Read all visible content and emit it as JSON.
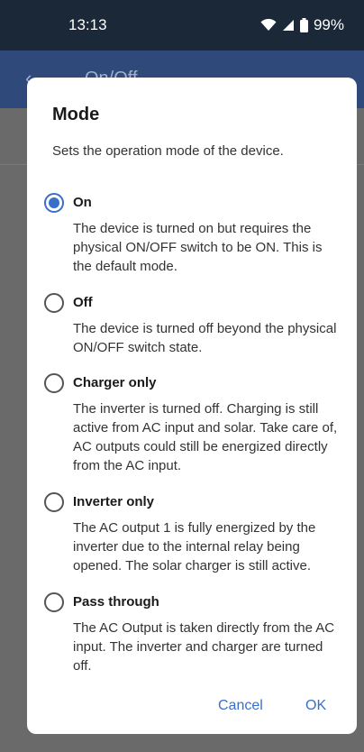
{
  "status_bar": {
    "time": "13:13",
    "battery": "99%"
  },
  "app_bar": {
    "title": "On/Off"
  },
  "dialog": {
    "title": "Mode",
    "description": "Sets the operation mode of the device.",
    "options": [
      {
        "label": "On",
        "selected": true,
        "description": "The device is turned on but requires the physical ON/OFF switch to be ON. This is the default mode."
      },
      {
        "label": "Off",
        "selected": false,
        "description": "The device is turned off beyond the physical ON/OFF switch state."
      },
      {
        "label": "Charger only",
        "selected": false,
        "description": "The inverter is turned off. Charging is still active from AC input and solar. Take care of, AC outputs could still be energized directly from the AC input."
      },
      {
        "label": "Inverter only",
        "selected": false,
        "description": "The AC output 1 is fully energized by the inverter due to the internal relay being opened. The solar charger is still active."
      },
      {
        "label": "Pass through",
        "selected": false,
        "description": "The AC Output is taken directly from the AC input. The inverter and charger are turned off."
      }
    ],
    "cancel_label": "Cancel",
    "ok_label": "OK"
  },
  "colors": {
    "accent": "#3a6fc9",
    "status_bar": "#1b2838",
    "app_bar": "#2f4a7a"
  }
}
